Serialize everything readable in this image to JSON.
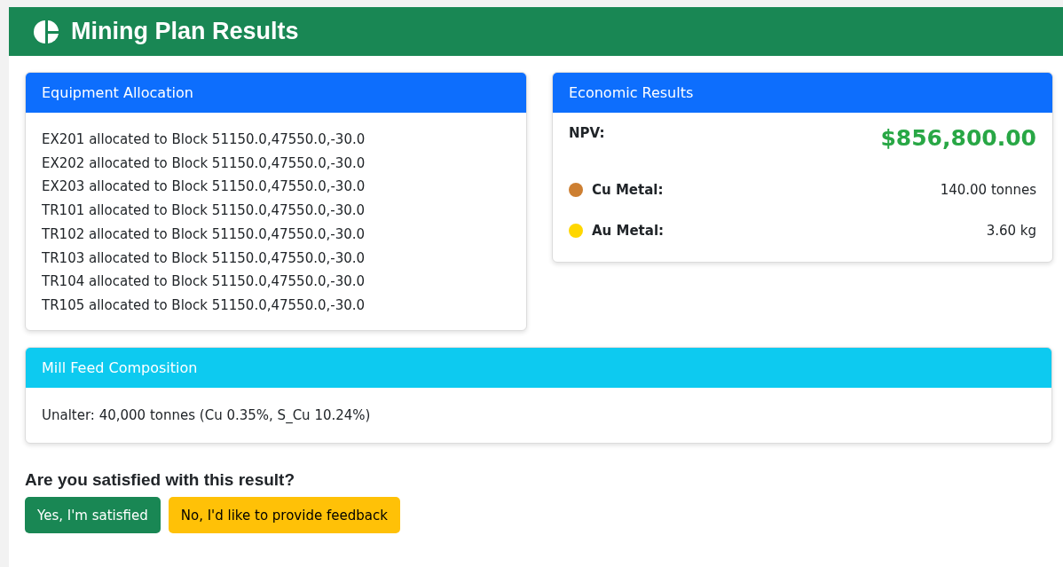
{
  "header": {
    "title": "Mining Plan Results"
  },
  "equipment": {
    "title": "Equipment Allocation",
    "items": [
      "EX201 allocated to Block 51150.0,47550.0,-30.0",
      "EX202 allocated to Block 51150.0,47550.0,-30.0",
      "EX203 allocated to Block 51150.0,47550.0,-30.0",
      "TR101 allocated to Block 51150.0,47550.0,-30.0",
      "TR102 allocated to Block 51150.0,47550.0,-30.0",
      "TR103 allocated to Block 51150.0,47550.0,-30.0",
      "TR104 allocated to Block 51150.0,47550.0,-30.0",
      "TR105 allocated to Block 51150.0,47550.0,-30.0"
    ]
  },
  "economic": {
    "title": "Economic Results",
    "npv_label": "NPV:",
    "npv_value": "$856,800.00",
    "metals": [
      {
        "label": "Cu Metal:",
        "value": "140.00 tonnes",
        "color": "#cd7f32"
      },
      {
        "label": "Au Metal:",
        "value": "3.60 kg",
        "color": "#ffd700"
      }
    ]
  },
  "mill_feed": {
    "title": "Mill Feed Composition",
    "items": [
      "Unalter: 40,000 tonnes (Cu 0.35%, S_Cu 10.24%)"
    ]
  },
  "feedback": {
    "question": "Are you satisfied with this result?",
    "buttons": [
      {
        "label": "Yes, I'm satisfied",
        "kind": "success"
      },
      {
        "label": "No, I'd like to provide feedback",
        "kind": "warning"
      }
    ]
  }
}
